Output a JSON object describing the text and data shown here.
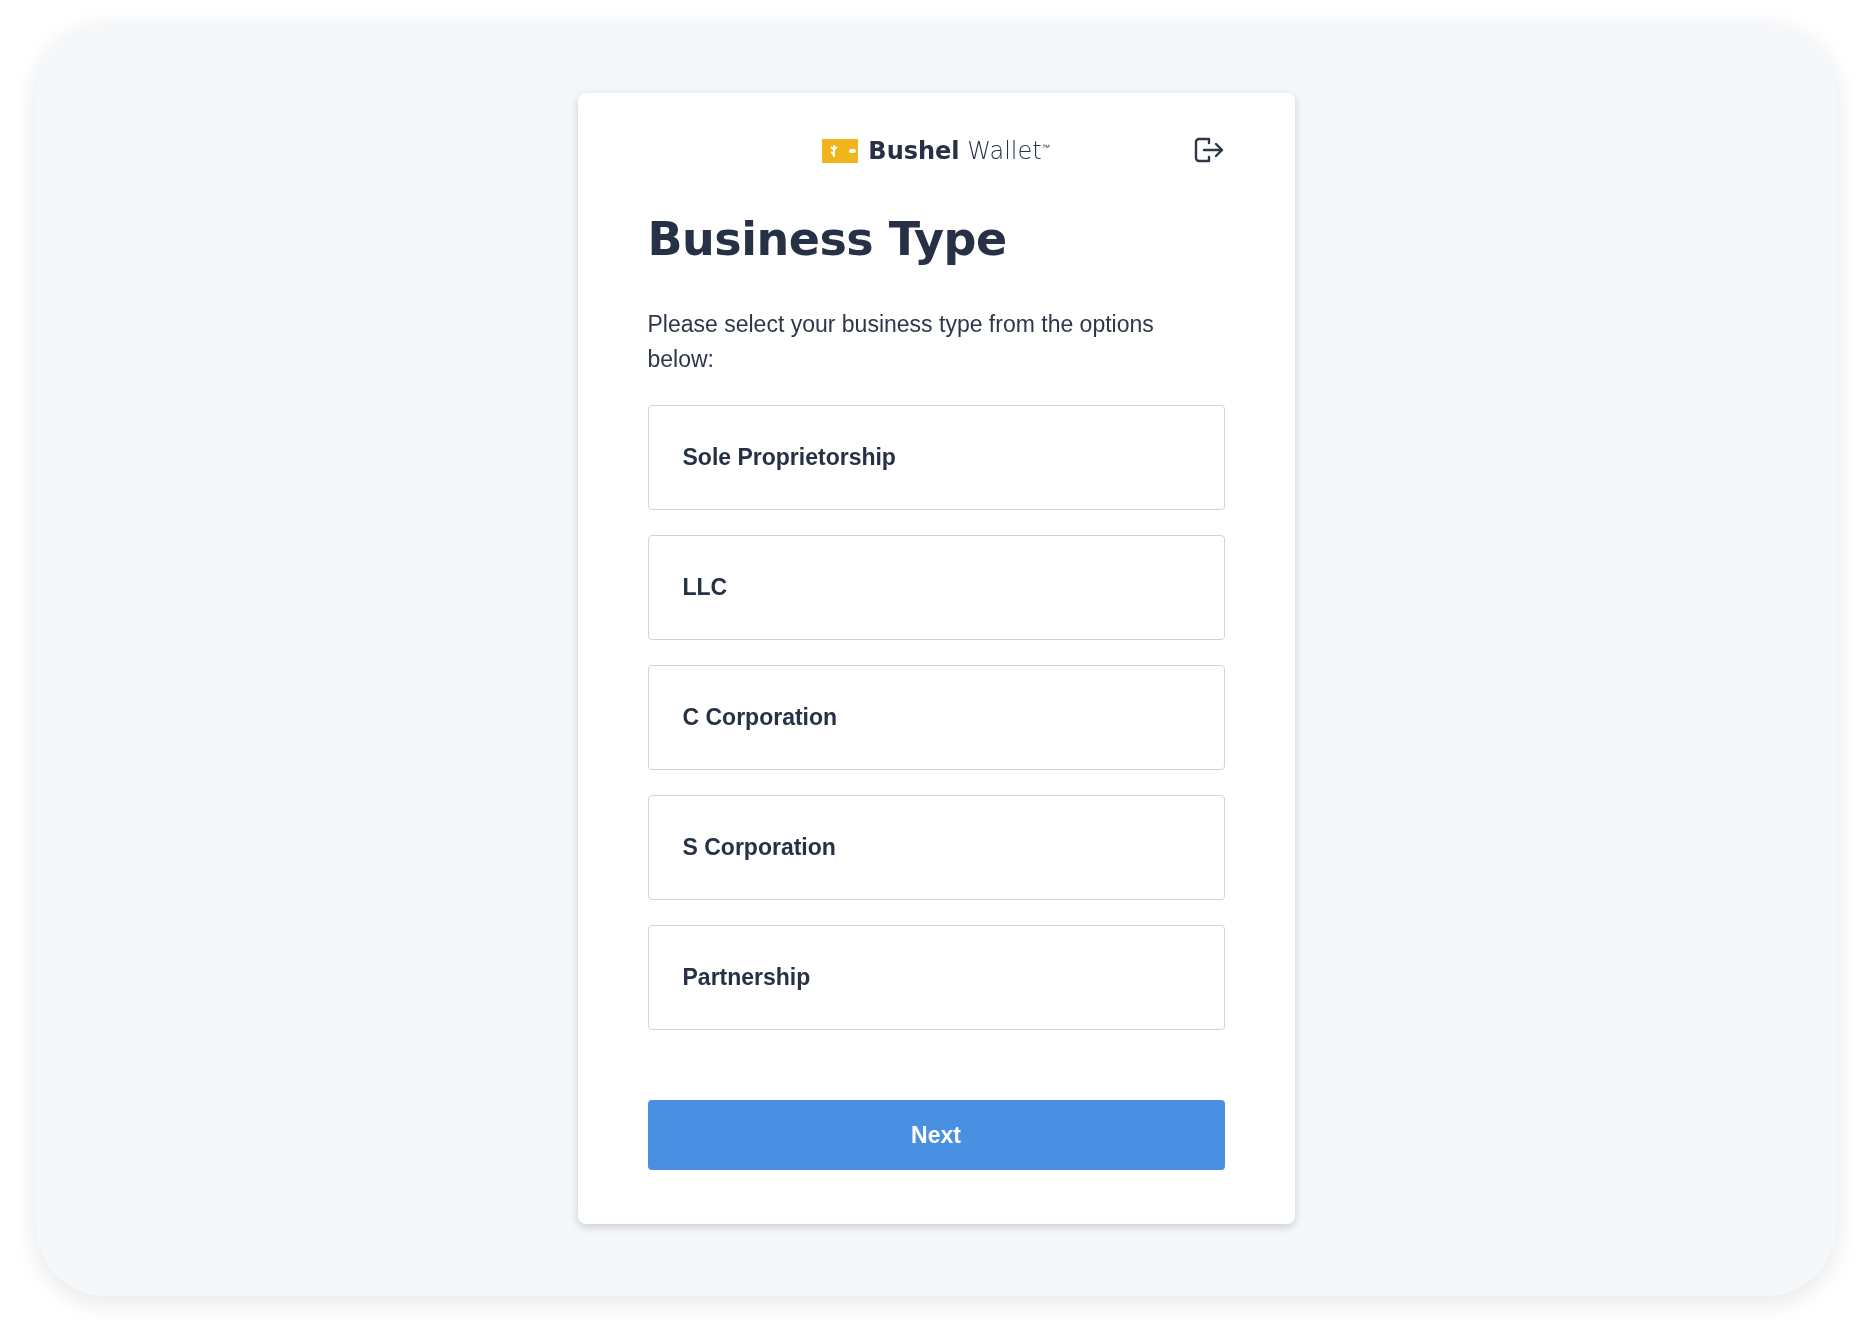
{
  "brand": {
    "name": "**Bushel** Wallet$^{™}$"
  },
  "title": "Business Type",
  "description": "Please select your business type from the options below:",
  "options": [
    {
      "label": "Sole Proprietorship",
      "selected": false
    },
    {
      "label": "LLC",
      "selected": false
    },
    {
      "label": "C Corporation",
      "selected": false
    },
    {
      "label": "S Corporation",
      "selected": false
    },
    {
      "label": "Partnership",
      "selected": false
    }
  ],
  "next_button": {
    "label": "Next"
  }
}
